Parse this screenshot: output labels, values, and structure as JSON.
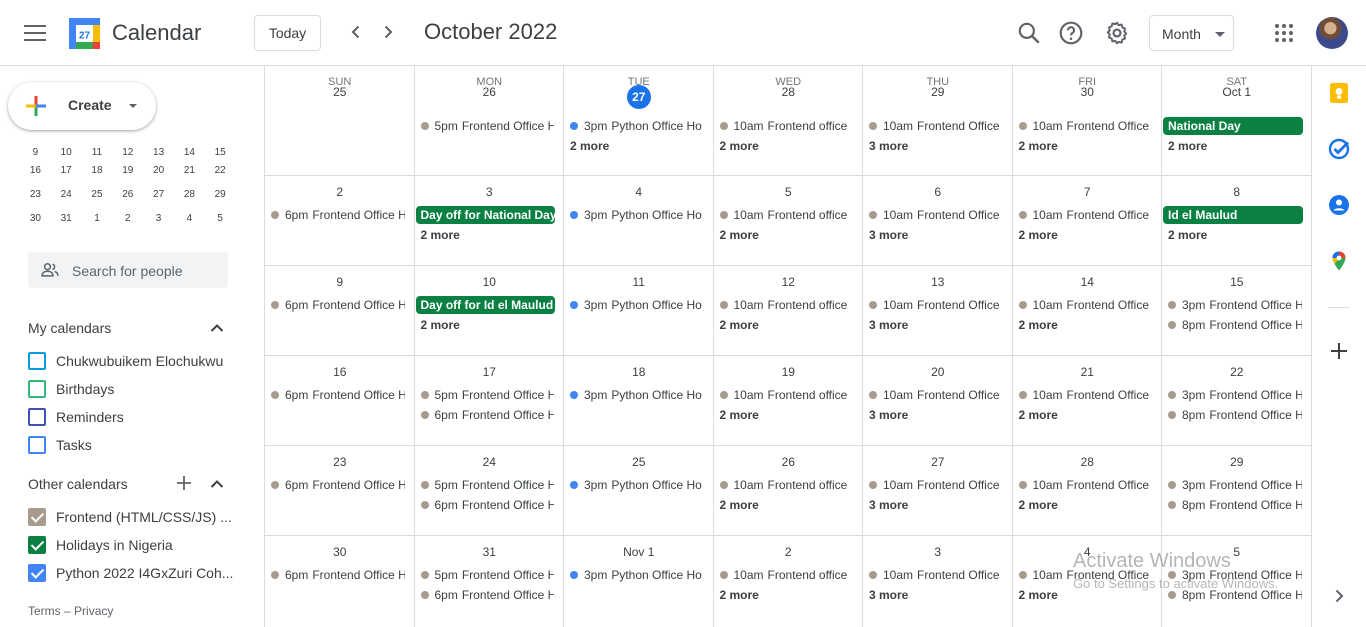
{
  "app": {
    "title": "Calendar",
    "logo_day": "27"
  },
  "header": {
    "today_label": "Today",
    "period": "October 2022",
    "view": "Month",
    "icons": [
      "menu-icon",
      "chevron-left-icon",
      "chevron-right-icon",
      "search-icon",
      "help-icon",
      "settings-icon",
      "apps-icon"
    ]
  },
  "sidebar": {
    "create_label": "Create",
    "mini_cal_rows": [
      [
        "9",
        "10",
        "11",
        "12",
        "13",
        "14",
        "15"
      ],
      [
        "16",
        "17",
        "18",
        "19",
        "20",
        "21",
        "22"
      ],
      [
        "23",
        "24",
        "25",
        "26",
        "27",
        "28",
        "29"
      ],
      [
        "30",
        "31",
        "1",
        "2",
        "3",
        "4",
        "5"
      ]
    ],
    "search_people_placeholder": "Search for people",
    "my_calendars_title": "My calendars",
    "my_calendars": [
      {
        "label": "Chukwubuikem Elochukwu",
        "color": "#039be5",
        "checked": false
      },
      {
        "label": "Birthdays",
        "color": "#33b679",
        "checked": false
      },
      {
        "label": "Reminders",
        "color": "#3f51b5",
        "checked": false
      },
      {
        "label": "Tasks",
        "color": "#4285f4",
        "checked": false
      }
    ],
    "other_calendars_title": "Other calendars",
    "other_calendars": [
      {
        "label": "Frontend (HTML/CSS/JS) ...",
        "color": "#a79b8e",
        "checked": true
      },
      {
        "label": "Holidays in Nigeria",
        "color": "#0b8043",
        "checked": true
      },
      {
        "label": "Python 2022 I4GxZuri Coh...",
        "color": "#4285f4",
        "checked": true
      }
    ],
    "footer": {
      "terms": "Terms",
      "sep": "–",
      "privacy": "Privacy"
    }
  },
  "grid": {
    "dow": [
      "SUN",
      "MON",
      "TUE",
      "WED",
      "THU",
      "FRI",
      "SAT"
    ],
    "colors": {
      "frontend": "#a79b8e",
      "python": "#4285f4",
      "holiday": "#0b8043",
      "today": "#1a73e8"
    },
    "weeks": [
      [
        {
          "num": "25",
          "events": []
        },
        {
          "num": "26",
          "events": [
            {
              "time": "5pm",
              "name": "Frontend Office H",
              "cal": "frontend"
            }
          ]
        },
        {
          "num": "27",
          "today": true,
          "events": [
            {
              "time": "3pm",
              "name": "Python Office Ho",
              "cal": "python"
            }
          ],
          "more": "2 more"
        },
        {
          "num": "28",
          "events": [
            {
              "time": "10am",
              "name": "Frontend office",
              "cal": "frontend"
            }
          ],
          "more": "2 more"
        },
        {
          "num": "29",
          "events": [
            {
              "time": "10am",
              "name": "Frontend Office",
              "cal": "frontend"
            }
          ],
          "more": "3 more"
        },
        {
          "num": "30",
          "events": [
            {
              "time": "10am",
              "name": "Frontend Office",
              "cal": "frontend"
            }
          ],
          "more": "2 more"
        },
        {
          "num": "Oct 1",
          "allday": "National Day",
          "events": [],
          "more": "2 more"
        }
      ],
      [
        {
          "num": "2",
          "events": [
            {
              "time": "6pm",
              "name": "Frontend Office H",
              "cal": "frontend"
            }
          ]
        },
        {
          "num": "3",
          "allday": "Day off for National Day",
          "events": [],
          "more": "2 more"
        },
        {
          "num": "4",
          "events": [
            {
              "time": "3pm",
              "name": "Python Office Ho",
              "cal": "python"
            }
          ]
        },
        {
          "num": "5",
          "events": [
            {
              "time": "10am",
              "name": "Frontend office",
              "cal": "frontend"
            }
          ],
          "more": "2 more"
        },
        {
          "num": "6",
          "events": [
            {
              "time": "10am",
              "name": "Frontend Office",
              "cal": "frontend"
            }
          ],
          "more": "3 more"
        },
        {
          "num": "7",
          "events": [
            {
              "time": "10am",
              "name": "Frontend Office",
              "cal": "frontend"
            }
          ],
          "more": "2 more"
        },
        {
          "num": "8",
          "allday": "Id el Maulud",
          "events": [],
          "more": "2 more"
        }
      ],
      [
        {
          "num": "9",
          "events": [
            {
              "time": "6pm",
              "name": "Frontend Office H",
              "cal": "frontend"
            }
          ]
        },
        {
          "num": "10",
          "allday": "Day off for Id el Maulud",
          "events": [],
          "more": "2 more"
        },
        {
          "num": "11",
          "events": [
            {
              "time": "3pm",
              "name": "Python Office Ho",
              "cal": "python"
            }
          ]
        },
        {
          "num": "12",
          "events": [
            {
              "time": "10am",
              "name": "Frontend office",
              "cal": "frontend"
            }
          ],
          "more": "2 more"
        },
        {
          "num": "13",
          "events": [
            {
              "time": "10am",
              "name": "Frontend Office",
              "cal": "frontend"
            }
          ],
          "more": "3 more"
        },
        {
          "num": "14",
          "events": [
            {
              "time": "10am",
              "name": "Frontend Office",
              "cal": "frontend"
            }
          ],
          "more": "2 more"
        },
        {
          "num": "15",
          "events": [
            {
              "time": "3pm",
              "name": "Frontend Office H",
              "cal": "frontend"
            },
            {
              "time": "8pm",
              "name": "Frontend Office H",
              "cal": "frontend"
            }
          ]
        }
      ],
      [
        {
          "num": "16",
          "events": [
            {
              "time": "6pm",
              "name": "Frontend Office H",
              "cal": "frontend"
            }
          ]
        },
        {
          "num": "17",
          "events": [
            {
              "time": "5pm",
              "name": "Frontend Office H",
              "cal": "frontend"
            },
            {
              "time": "6pm",
              "name": "Frontend Office H",
              "cal": "frontend"
            }
          ]
        },
        {
          "num": "18",
          "events": [
            {
              "time": "3pm",
              "name": "Python Office Ho",
              "cal": "python"
            }
          ]
        },
        {
          "num": "19",
          "events": [
            {
              "time": "10am",
              "name": "Frontend office",
              "cal": "frontend"
            }
          ],
          "more": "2 more"
        },
        {
          "num": "20",
          "events": [
            {
              "time": "10am",
              "name": "Frontend Office",
              "cal": "frontend"
            }
          ],
          "more": "3 more"
        },
        {
          "num": "21",
          "events": [
            {
              "time": "10am",
              "name": "Frontend Office",
              "cal": "frontend"
            }
          ],
          "more": "2 more"
        },
        {
          "num": "22",
          "events": [
            {
              "time": "3pm",
              "name": "Frontend Office H",
              "cal": "frontend"
            },
            {
              "time": "8pm",
              "name": "Frontend Office H",
              "cal": "frontend"
            }
          ]
        }
      ],
      [
        {
          "num": "23",
          "events": [
            {
              "time": "6pm",
              "name": "Frontend Office H",
              "cal": "frontend"
            }
          ]
        },
        {
          "num": "24",
          "events": [
            {
              "time": "5pm",
              "name": "Frontend Office H",
              "cal": "frontend"
            },
            {
              "time": "6pm",
              "name": "Frontend Office H",
              "cal": "frontend"
            }
          ]
        },
        {
          "num": "25",
          "events": [
            {
              "time": "3pm",
              "name": "Python Office Ho",
              "cal": "python"
            }
          ]
        },
        {
          "num": "26",
          "events": [
            {
              "time": "10am",
              "name": "Frontend office",
              "cal": "frontend"
            }
          ],
          "more": "2 more"
        },
        {
          "num": "27",
          "events": [
            {
              "time": "10am",
              "name": "Frontend Office",
              "cal": "frontend"
            }
          ],
          "more": "3 more"
        },
        {
          "num": "28",
          "events": [
            {
              "time": "10am",
              "name": "Frontend Office",
              "cal": "frontend"
            }
          ],
          "more": "2 more"
        },
        {
          "num": "29",
          "events": [
            {
              "time": "3pm",
              "name": "Frontend Office H",
              "cal": "frontend"
            },
            {
              "time": "8pm",
              "name": "Frontend Office H",
              "cal": "frontend"
            }
          ]
        }
      ],
      [
        {
          "num": "30",
          "events": [
            {
              "time": "6pm",
              "name": "Frontend Office H",
              "cal": "frontend"
            }
          ]
        },
        {
          "num": "31",
          "events": [
            {
              "time": "5pm",
              "name": "Frontend Office H",
              "cal": "frontend"
            },
            {
              "time": "6pm",
              "name": "Frontend Office H",
              "cal": "frontend"
            }
          ]
        },
        {
          "num": "Nov 1",
          "events": [
            {
              "time": "3pm",
              "name": "Python Office Ho",
              "cal": "python"
            }
          ]
        },
        {
          "num": "2",
          "events": [
            {
              "time": "10am",
              "name": "Frontend office",
              "cal": "frontend"
            }
          ],
          "more": "2 more"
        },
        {
          "num": "3",
          "events": [
            {
              "time": "10am",
              "name": "Frontend Office",
              "cal": "frontend"
            }
          ],
          "more": "3 more"
        },
        {
          "num": "4",
          "events": [
            {
              "time": "10am",
              "name": "Frontend Office",
              "cal": "frontend"
            }
          ],
          "more": "2 more"
        },
        {
          "num": "5",
          "events": [
            {
              "time": "3pm",
              "name": "Frontend Office H",
              "cal": "frontend"
            },
            {
              "time": "8pm",
              "name": "Frontend Office H",
              "cal": "frontend"
            }
          ]
        }
      ]
    ]
  },
  "rail": {
    "icons": [
      "keep-icon",
      "tasks-icon",
      "contacts-icon",
      "maps-icon",
      "add-icon",
      "expand-icon"
    ]
  },
  "watermark": {
    "line1": "Activate Windows",
    "line2": "Go to Settings to activate Windows."
  }
}
